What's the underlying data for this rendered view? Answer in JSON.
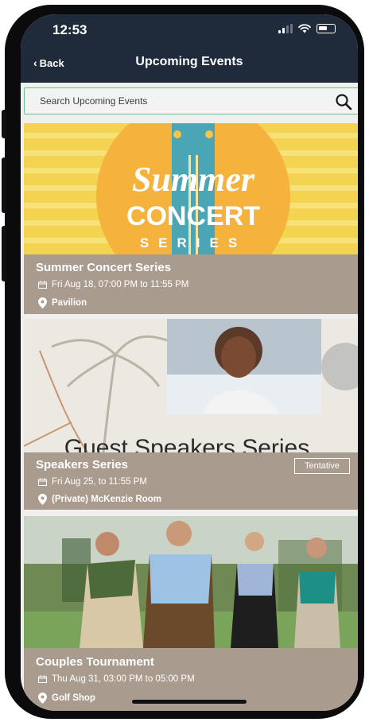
{
  "status_bar": {
    "time": "12:53"
  },
  "header": {
    "back_label": "Back",
    "title": "Upcoming Events"
  },
  "search": {
    "placeholder": "Search Upcoming Events"
  },
  "events": [
    {
      "title": "Summer Concert Series",
      "datetime": "Fri Aug 18, 07:00 PM to 11:55 PM",
      "location": "Pavilion",
      "banner": {
        "line1": "Summer",
        "line2": "CONCERT",
        "line3": "SERIES"
      }
    },
    {
      "title": "Speakers Series",
      "datetime": "Fri Aug 25,  to 11:55 PM",
      "location": "(Private) McKenzie Room",
      "tag": "Tentative",
      "banner": {
        "text": "Guest Speakers Series"
      }
    },
    {
      "title": "Couples Tournament",
      "datetime": "Thu Aug 31, 03:00 PM to 05:00 PM",
      "location": "Golf Shop"
    }
  ],
  "colors": {
    "header_bg": "#1f2a3b",
    "info_bg": "#a99c8e",
    "search_border": "#6ebc96",
    "accent_dot": "#c0262e"
  }
}
